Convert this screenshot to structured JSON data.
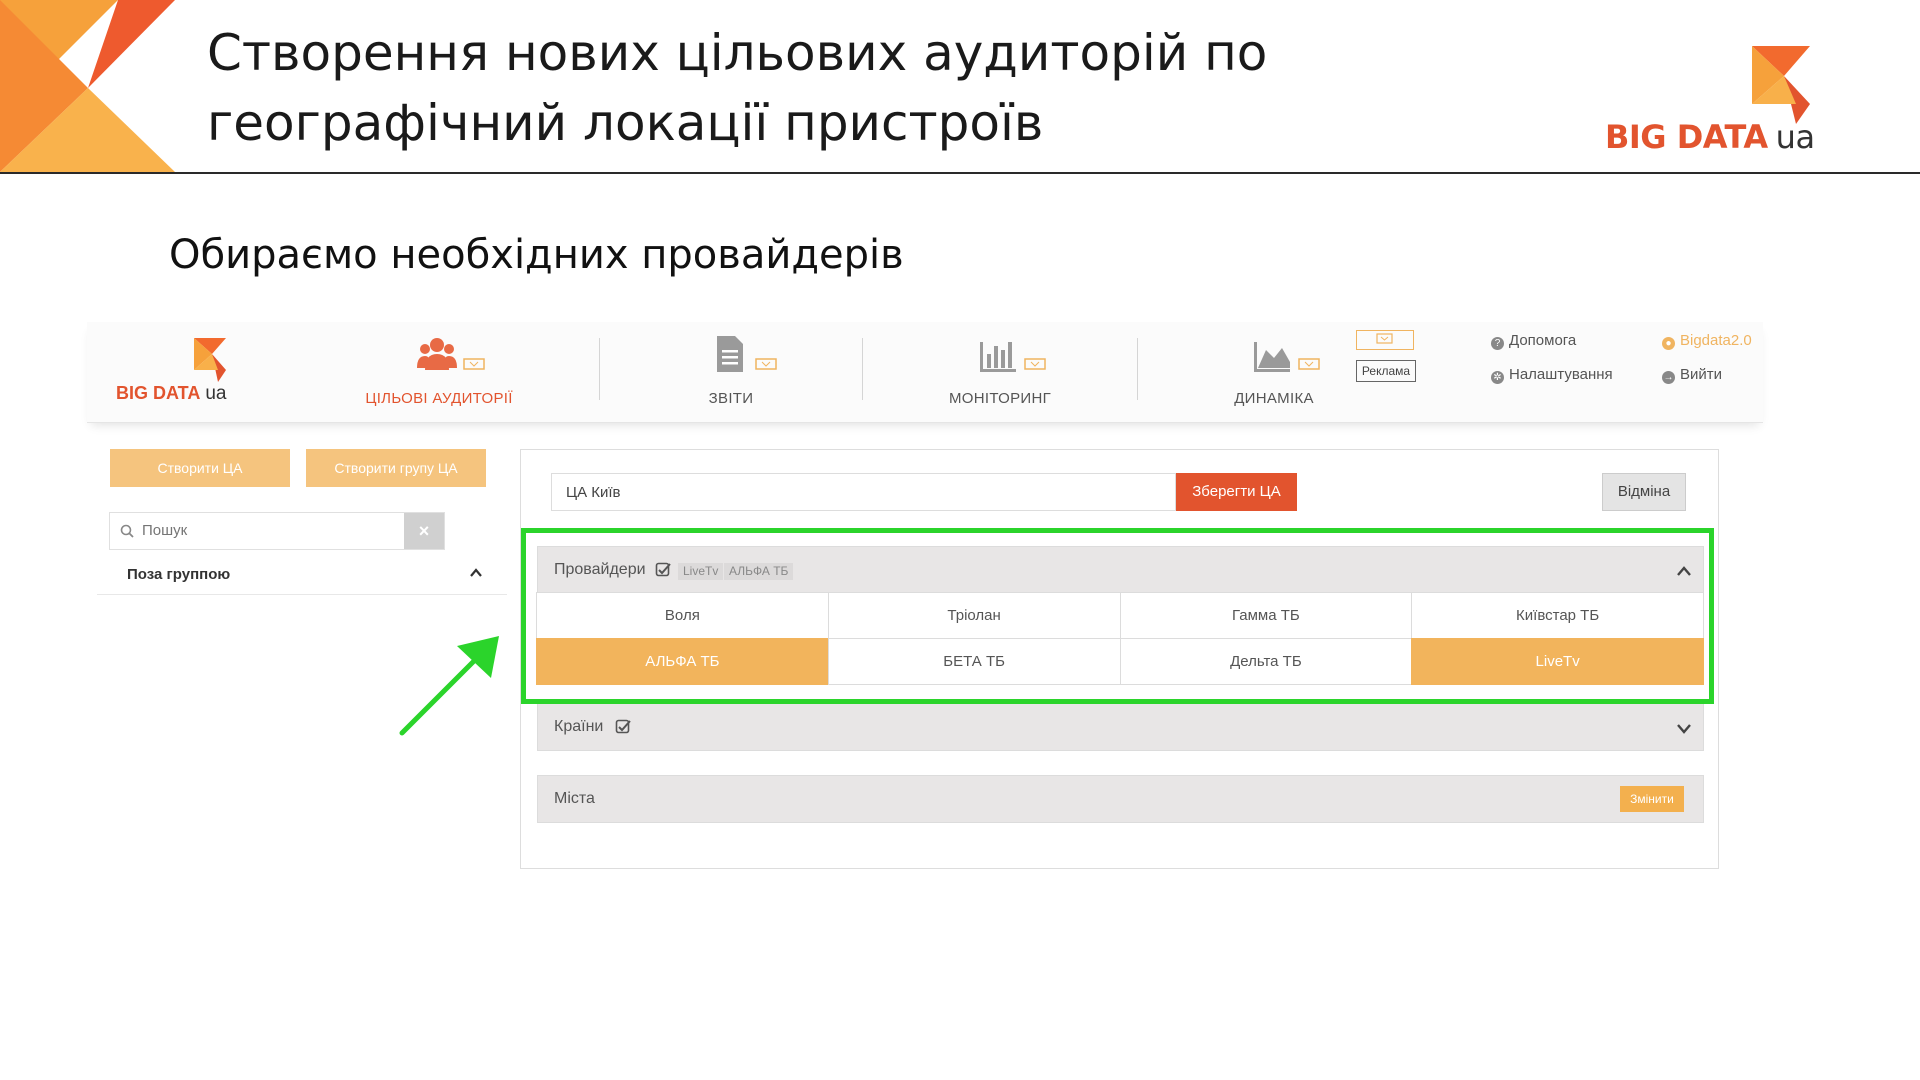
{
  "slide": {
    "title_line1": "Створення нових цільових аудиторій по",
    "title_line2": "географічний локації пристроїв",
    "brand": "BIG DATA",
    "brand_suffix": "ua",
    "subtitle": "Обираємо необхідних провайдерів",
    "accent_color": "#e2542e",
    "secondary_color": "#f5a623",
    "highlight_color": "#2bd42b"
  },
  "app": {
    "logo": "BIG DATA",
    "logo_suffix": "ua",
    "nav": {
      "audiences": "ЦІЛЬОВІ АУДИТОРІЇ",
      "reports": "ЗВІТИ",
      "monitoring": "МОНІТОРИНГ",
      "dynamics": "ДИНАМІКА",
      "ads": "Реклама"
    },
    "links": {
      "help": "Допомога",
      "settings": "Налаштування",
      "user": "Bigdata2.0",
      "logout": "Вийти"
    },
    "sidebar": {
      "create_audience": "Створити ЦА",
      "create_group": "Створити групу ЦА",
      "search_placeholder": "Пошук",
      "clear": "×",
      "group_label": "Поза группою"
    },
    "form": {
      "audience_name": "ЦА Київ",
      "save": "Зберегти ЦА",
      "cancel": "Відміна"
    },
    "providers": {
      "title": "Провайдери",
      "tags": [
        "LiveTv",
        "АЛЬФА ТБ"
      ],
      "items": [
        {
          "label": "Воля",
          "selected": false
        },
        {
          "label": "Тріолан",
          "selected": false
        },
        {
          "label": "Гамма ТБ",
          "selected": false
        },
        {
          "label": "Київстар ТБ",
          "selected": false
        },
        {
          "label": "АЛЬФА ТБ",
          "selected": true
        },
        {
          "label": "БЕТА ТБ",
          "selected": false
        },
        {
          "label": "Дельта ТБ",
          "selected": false
        },
        {
          "label": "LiveTv",
          "selected": true
        }
      ]
    },
    "countries": {
      "title": "Країни"
    },
    "cities": {
      "title": "Міста",
      "change": "Змінити"
    }
  }
}
